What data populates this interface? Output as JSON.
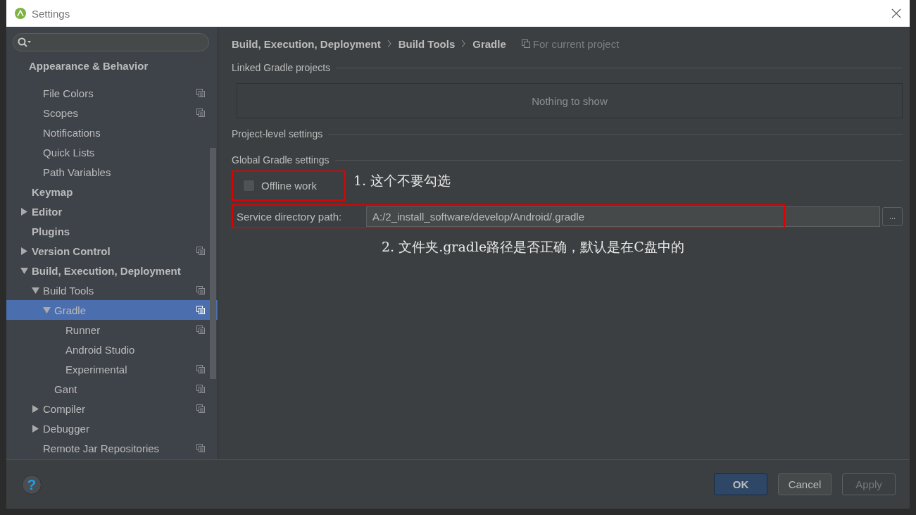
{
  "window": {
    "title": "Settings"
  },
  "sidebar": {
    "sticky_header": "Appearance & Behavior",
    "items": [
      {
        "label": "File Colors",
        "bold": false,
        "copy": true,
        "selected": false
      },
      {
        "label": "Scopes",
        "bold": false,
        "copy": true,
        "selected": false
      },
      {
        "label": "Notifications",
        "bold": false,
        "copy": false,
        "selected": false
      },
      {
        "label": "Quick Lists",
        "bold": false,
        "copy": false,
        "selected": false
      },
      {
        "label": "Path Variables",
        "bold": false,
        "copy": false,
        "selected": false
      }
    ],
    "tree": [
      {
        "label": "Keymap",
        "bold": true,
        "copy": false,
        "selected": false
      },
      {
        "label": "Editor",
        "bold": true,
        "expanded": false,
        "copy": false,
        "selected": false
      },
      {
        "label": "Plugins",
        "bold": true,
        "copy": false,
        "selected": false
      },
      {
        "label": "Version Control",
        "bold": true,
        "expanded": false,
        "copy": true,
        "selected": false
      },
      {
        "label": "Build, Execution, Deployment",
        "bold": true,
        "expanded": true,
        "copy": false,
        "selected": false,
        "children": [
          {
            "label": "Build Tools",
            "bold": false,
            "expanded": true,
            "copy": true,
            "selected": false,
            "children": [
              {
                "label": "Gradle",
                "bold": false,
                "expanded": true,
                "copy": true,
                "selected": true,
                "children": [
                  {
                    "label": "Runner",
                    "bold": false,
                    "copy": true,
                    "selected": false
                  },
                  {
                    "label": "Android Studio",
                    "bold": false,
                    "copy": false,
                    "selected": false
                  },
                  {
                    "label": "Experimental",
                    "bold": false,
                    "copy": true,
                    "selected": false
                  }
                ]
              },
              {
                "label": "Gant",
                "bold": false,
                "copy": true,
                "selected": false
              }
            ]
          },
          {
            "label": "Compiler",
            "bold": false,
            "expanded": false,
            "copy": true,
            "selected": false
          },
          {
            "label": "Debugger",
            "bold": false,
            "expanded": false,
            "copy": false,
            "selected": false
          },
          {
            "label": "Remote Jar Repositories",
            "bold": false,
            "copy": true,
            "selected": false
          }
        ]
      }
    ]
  },
  "breadcrumb": [
    "Build, Execution, Deployment",
    "Build Tools",
    "Gradle"
  ],
  "scope_label": "For current project",
  "linked_section": {
    "title": "Linked Gradle projects",
    "empty_text": "Nothing to show"
  },
  "project_section": {
    "title": "Project-level settings"
  },
  "global_section": {
    "title": "Global Gradle settings",
    "offline_work": {
      "label": "Offline work",
      "checked": false
    },
    "service_path": {
      "label": "Service directory path:",
      "value": "A:/2_install_software/develop/Android/.gradle",
      "browse": "..."
    }
  },
  "annotations": [
    "1. 这个不要勾选",
    "2. 文件夹.gradle路径是否正确，默认是在C盘中的"
  ],
  "buttons": [
    {
      "label": "OK",
      "kind": "default",
      "disabled": false
    },
    {
      "label": "Cancel",
      "kind": "normal",
      "disabled": false
    },
    {
      "label": "Apply",
      "kind": "normal",
      "disabled": true
    }
  ],
  "help": "?"
}
